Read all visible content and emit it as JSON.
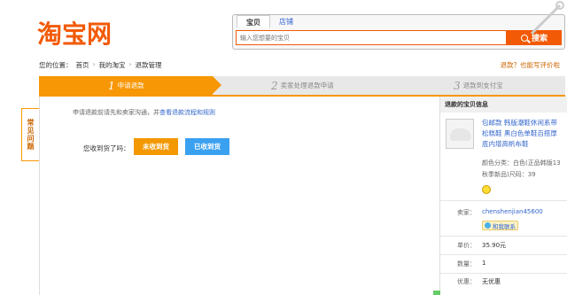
{
  "logo": "淘宝网",
  "search": {
    "tabs": [
      "宝贝",
      "店铺"
    ],
    "placeholder": "输入您想要的宝贝",
    "button": "搜索"
  },
  "breadcrumb": {
    "prefix": "您的位置：",
    "items": [
      "首页",
      "我的淘宝",
      "退款管理"
    ]
  },
  "refund_link": "退款？也能写评价啦",
  "steps": [
    {
      "num": "1",
      "label": "申请退款"
    },
    {
      "num": "2",
      "label": "卖家处理退款申请"
    },
    {
      "num": "3",
      "label": "退款到支付宝"
    }
  ],
  "side_tab": "常见问题",
  "notice": {
    "text": "申请退款前请先和卖家沟通，并",
    "link": "查看退款流程和规则"
  },
  "question": "您收到货了吗：",
  "buttons": {
    "not_received": "未收到货",
    "received": "已收到货"
  },
  "info": {
    "title": "退款的宝贝信息",
    "product_name": "包邮款 韩版潮鞋休闲系带松糕鞋 黑白色单鞋百搭厚底内增高帆布鞋",
    "product_meta": "颜色分类：白色(正品韩版13秋季新品)尺码：39",
    "seller_label": "卖家：",
    "seller": "chenshenjian45600",
    "contact": "和我联系",
    "price_label": "单价：",
    "price": "35.90元",
    "qty_label": "数量：",
    "qty": "1",
    "discount_label": "优惠：",
    "discount": "无优惠"
  }
}
